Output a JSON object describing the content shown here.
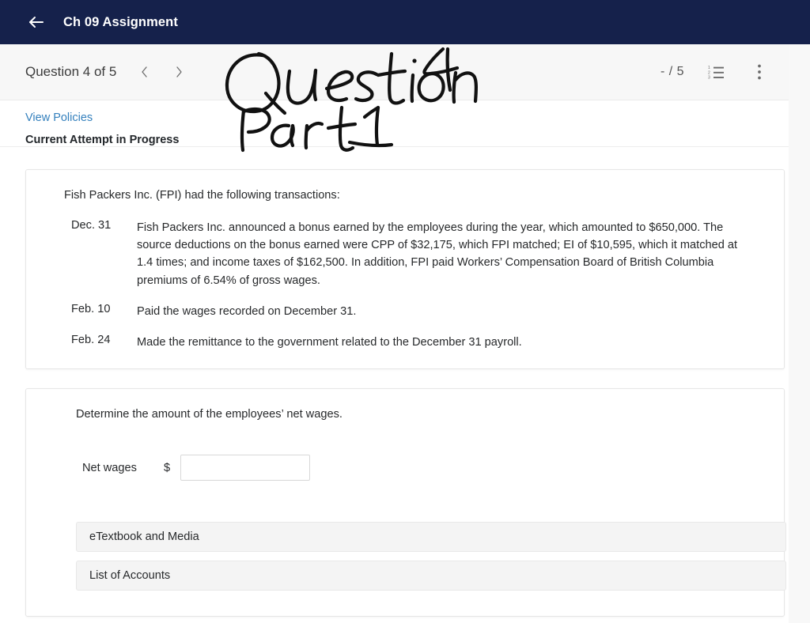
{
  "appbar": {
    "back_icon": "arrow-left-icon",
    "title": "Ch 09 Assignment"
  },
  "toolbar": {
    "question_counter": "Question 4 of 5",
    "prev_icon": "chevron-left-icon",
    "next_icon": "chevron-right-icon",
    "score": "- / 5",
    "list_icon": "numbered-list-icon",
    "menu_icon": "more-vertical-icon"
  },
  "subbar": {
    "view_policies": "View Policies",
    "attempt_status": "Current Attempt in Progress"
  },
  "question_card": {
    "intro": "Fish Packers Inc. (FPI) had the following transactions:",
    "transactions": [
      {
        "date": "Dec. 31",
        "description": "Fish Packers Inc. announced a bonus earned by the employees during the year, which amounted to $650,000. The source deductions on the bonus earned were CPP of $32,175, which FPI matched; EI of $10,595, which it matched at 1.4 times; and income taxes of $162,500. In addition, FPI paid Workers’ Compensation Board of British Columbia premiums of 6.54% of gross wages."
      },
      {
        "date": "Feb. 10",
        "description": "Paid the wages recorded on December 31."
      },
      {
        "date": "Feb. 24",
        "description": "Made the remittance to the government related to the December 31 payroll."
      }
    ]
  },
  "answer_card": {
    "prompt": "Determine the amount of the employees’ net wages.",
    "answer_label": "Net wages",
    "currency_symbol": "$",
    "answer_value": "",
    "answer_placeholder": "",
    "etextbook_button": "eTextbook and Media",
    "accounts_button": "List of Accounts"
  },
  "annotation": {
    "line1": "Question 4",
    "line2": "Part 1",
    "underlined": "Part 1"
  },
  "colors": {
    "appbar_bg": "#15214b",
    "link_blue": "#3480bd",
    "page_bg": "#f8f8f8",
    "toolbar_bg": "#f7f7f7",
    "card_border": "#e6e6e6",
    "button_bg": "#f4f4f4",
    "ink": "#111111"
  }
}
